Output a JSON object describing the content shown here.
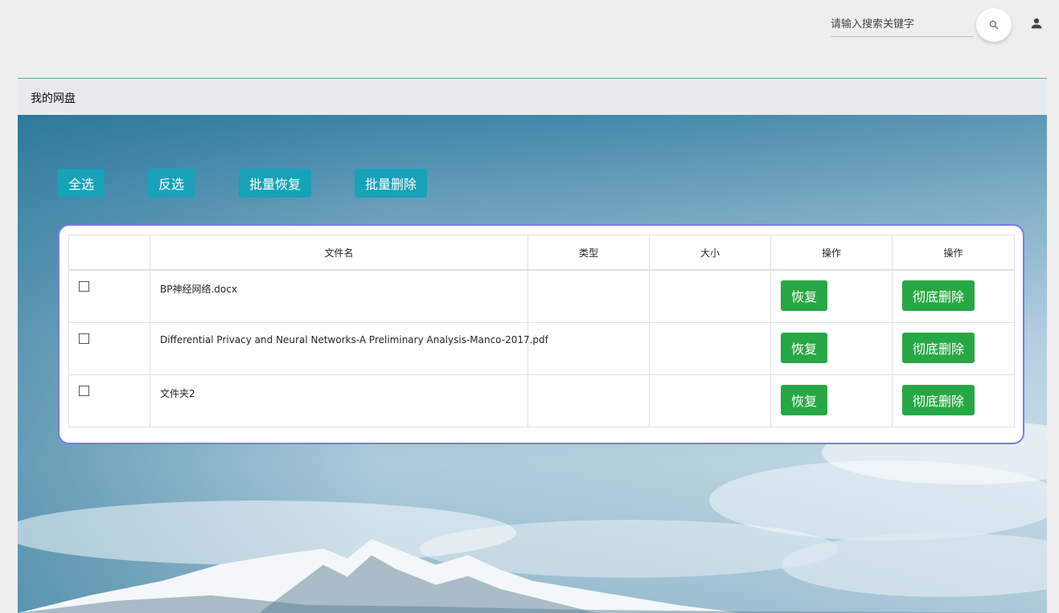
{
  "header": {
    "search_placeholder": "请输入搜索关键字",
    "search_icon": "search-icon",
    "user_icon": "person-icon"
  },
  "panel": {
    "title": "我的网盘"
  },
  "toolbar": {
    "select_all": "全选",
    "invert_selection": "反选",
    "batch_restore": "批量恢复",
    "batch_delete": "批量删除"
  },
  "table": {
    "columns": [
      "",
      "文件名",
      "类型",
      "大小",
      "操作",
      "操作"
    ],
    "rows": [
      {
        "name": "BP神经网络.docx",
        "type": "",
        "size": "",
        "restore": "恢复",
        "delete": "彻底删除"
      },
      {
        "name": "Differential Privacy and Neural Networks-A Preliminary Analysis-Manco-2017.pdf",
        "type": "",
        "size": "",
        "restore": "恢复",
        "delete": "彻底删除"
      },
      {
        "name": "文件夹2",
        "type": "",
        "size": "",
        "restore": "恢复",
        "delete": "彻底删除"
      }
    ]
  },
  "colors": {
    "info": "#17a2b8",
    "success": "#28a745",
    "card_border": "#7b7be8"
  }
}
